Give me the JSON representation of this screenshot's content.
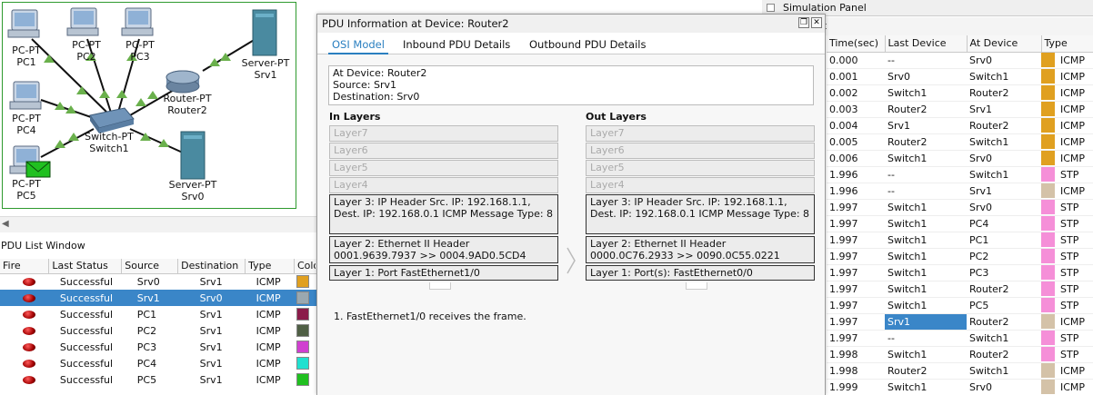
{
  "topology": {
    "devices": [
      {
        "type": "PC-PT",
        "name": "PC1"
      },
      {
        "type": "PC-PT",
        "name": "PC2"
      },
      {
        "type": "PC-PT",
        "name": "PC3"
      },
      {
        "type": "PC-PT",
        "name": "PC4"
      },
      {
        "type": "PC-PT",
        "name": "PC5"
      },
      {
        "type": "Switch-PT",
        "name": "Switch1"
      },
      {
        "type": "Router-PT",
        "name": "Router2"
      },
      {
        "type": "Server-PT",
        "name": "Srv1"
      },
      {
        "type": "Server-PT",
        "name": "Srv0"
      }
    ],
    "link_color": "#6ab04c"
  },
  "pdu_list": {
    "title": "PDU List Window",
    "columns": [
      "Fire",
      "Last Status",
      "Source",
      "Destination",
      "Type",
      "Color"
    ],
    "rows": [
      {
        "status": "Successful",
        "source": "Srv0",
        "destination": "Srv1",
        "type": "ICMP",
        "color": "#e0a020"
      },
      {
        "status": "Successful",
        "source": "Srv1",
        "destination": "Srv0",
        "type": "ICMP",
        "color": "#9aa8b0"
      },
      {
        "status": "Successful",
        "source": "PC1",
        "destination": "Srv1",
        "type": "ICMP",
        "color": "#8b1c4a"
      },
      {
        "status": "Successful",
        "source": "PC2",
        "destination": "Srv1",
        "type": "ICMP",
        "color": "#4f5f45"
      },
      {
        "status": "Successful",
        "source": "PC3",
        "destination": "Srv1",
        "type": "ICMP",
        "color": "#d040d0"
      },
      {
        "status": "Successful",
        "source": "PC4",
        "destination": "Srv1",
        "type": "ICMP",
        "color": "#20e0d0"
      },
      {
        "status": "Successful",
        "source": "PC5",
        "destination": "Srv1",
        "type": "ICMP",
        "color": "#20c020"
      }
    ],
    "selected_row": 1
  },
  "simulation_panel": {
    "title": "Simulation Panel",
    "subtitle_fragment": "st",
    "columns": [
      "Time(sec)",
      "Last Device",
      "At Device",
      "Type"
    ],
    "events": [
      {
        "time": "0.000",
        "last": "--",
        "at": "Srv0",
        "type": "ICMP",
        "color": "#e0a020"
      },
      {
        "time": "0.001",
        "last": "Srv0",
        "at": "Switch1",
        "type": "ICMP",
        "color": "#e0a020"
      },
      {
        "time": "0.002",
        "last": "Switch1",
        "at": "Router2",
        "type": "ICMP",
        "color": "#e0a020"
      },
      {
        "time": "0.003",
        "last": "Router2",
        "at": "Srv1",
        "type": "ICMP",
        "color": "#e0a020"
      },
      {
        "time": "0.004",
        "last": "Srv1",
        "at": "Router2",
        "type": "ICMP",
        "color": "#e0a020"
      },
      {
        "time": "0.005",
        "last": "Router2",
        "at": "Switch1",
        "type": "ICMP",
        "color": "#e0a020"
      },
      {
        "time": "0.006",
        "last": "Switch1",
        "at": "Srv0",
        "type": "ICMP",
        "color": "#e0a020"
      },
      {
        "time": "1.996",
        "last": "--",
        "at": "Switch1",
        "type": "STP",
        "color": "#f58fd8"
      },
      {
        "time": "1.996",
        "last": "--",
        "at": "Srv1",
        "type": "ICMP",
        "color": "#d4c2a8"
      },
      {
        "time": "1.997",
        "last": "Switch1",
        "at": "Srv0",
        "type": "STP",
        "color": "#f58fd8"
      },
      {
        "time": "1.997",
        "last": "Switch1",
        "at": "PC4",
        "type": "STP",
        "color": "#f58fd8"
      },
      {
        "time": "1.997",
        "last": "Switch1",
        "at": "PC1",
        "type": "STP",
        "color": "#f58fd8"
      },
      {
        "time": "1.997",
        "last": "Switch1",
        "at": "PC2",
        "type": "STP",
        "color": "#f58fd8"
      },
      {
        "time": "1.997",
        "last": "Switch1",
        "at": "PC3",
        "type": "STP",
        "color": "#f58fd8"
      },
      {
        "time": "1.997",
        "last": "Switch1",
        "at": "Router2",
        "type": "STP",
        "color": "#f58fd8"
      },
      {
        "time": "1.997",
        "last": "Switch1",
        "at": "PC5",
        "type": "STP",
        "color": "#f58fd8"
      },
      {
        "time": "1.997",
        "last": "Srv1",
        "at": "Router2",
        "type": "ICMP",
        "color": "#d4c2a8",
        "selected_last": true
      },
      {
        "time": "1.997",
        "last": "--",
        "at": "Switch1",
        "type": "STP",
        "color": "#f58fd8"
      },
      {
        "time": "1.998",
        "last": "Switch1",
        "at": "Router2",
        "type": "STP",
        "color": "#f58fd8"
      },
      {
        "time": "1.998",
        "last": "Router2",
        "at": "Switch1",
        "type": "ICMP",
        "color": "#d4c2a8"
      },
      {
        "time": "1.999",
        "last": "Switch1",
        "at": "Srv0",
        "type": "ICMP",
        "color": "#d4c2a8"
      }
    ]
  },
  "pdu_dialog": {
    "title": "PDU Information at Device: Router2",
    "tabs": [
      "OSI Model",
      "Inbound PDU Details",
      "Outbound PDU Details"
    ],
    "active_tab": 0,
    "summary": [
      "At Device: Router2",
      "Source: Srv1",
      "Destination: Srv0"
    ],
    "in_layers_title": "In Layers",
    "out_layers_title": "Out Layers",
    "in_layers": {
      "inactive": [
        "Layer7",
        "Layer6",
        "Layer5",
        "Layer4"
      ],
      "layer3": "Layer 3: IP Header Src. IP: 192.168.1.1, Dest. IP: 192.168.0.1 ICMP Message Type: 8",
      "layer2_title": "Layer 2: Ethernet II Header",
      "layer2_detail": "0001.9639.7937 >> 0004.9AD0.5CD4",
      "layer1": "Layer 1: Port FastEthernet1/0"
    },
    "out_layers": {
      "inactive": [
        "Layer7",
        "Layer6",
        "Layer5",
        "Layer4"
      ],
      "layer3": "Layer 3: IP Header Src. IP: 192.168.1.1, Dest. IP: 192.168.0.1 ICMP Message Type: 8",
      "layer2_title": "Layer 2: Ethernet II Header",
      "layer2_detail": "0000.0C76.2933 >> 0090.0C55.0221",
      "layer1": "Layer 1: Port(s): FastEthernet0/0"
    },
    "description": "1. FastEthernet1/0 receives the frame."
  }
}
